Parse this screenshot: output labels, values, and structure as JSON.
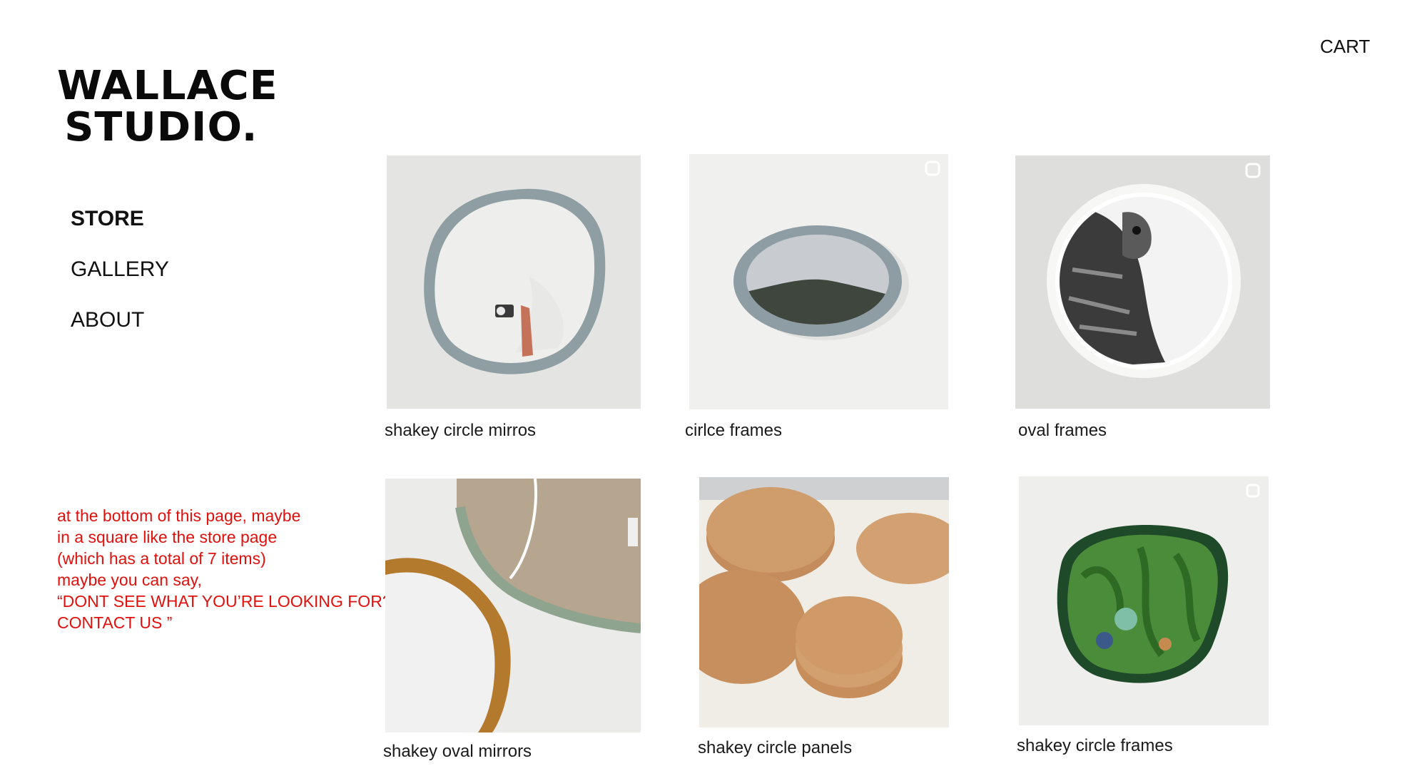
{
  "brand": {
    "line1": "WALLACE",
    "line2": "STUDIO."
  },
  "header": {
    "cart_label": "CART"
  },
  "nav": {
    "items": [
      {
        "label": "STORE",
        "active": true
      },
      {
        "label": "GALLERY",
        "active": false
      },
      {
        "label": "ABOUT",
        "active": false
      }
    ]
  },
  "note": {
    "color": "#e0100d",
    "lines": [
      "at the bottom of this page, maybe",
      "in a square like the store page",
      "(which has a total of 7 items)",
      "maybe you can say,",
      "“DONT SEE WHAT YOU’RE LOOKING FOR?",
      "CONTACT US ”"
    ]
  },
  "products": [
    {
      "caption": "shakey circle mirros",
      "image": "grey-wobbly-mirror-photo"
    },
    {
      "caption": "cirlce frames",
      "image": "grey-oval-frame-landscape-photo"
    },
    {
      "caption": "oval frames",
      "image": "white-round-frame-owl-photo"
    },
    {
      "caption": "shakey oval mirrors",
      "image": "wood-and-sage-mirrors-photo"
    },
    {
      "caption": "shakey circle panels",
      "image": "stacked-wood-panels-photo"
    },
    {
      "caption": "shakey circle frames",
      "image": "green-frame-foliage-art-photo"
    }
  ]
}
